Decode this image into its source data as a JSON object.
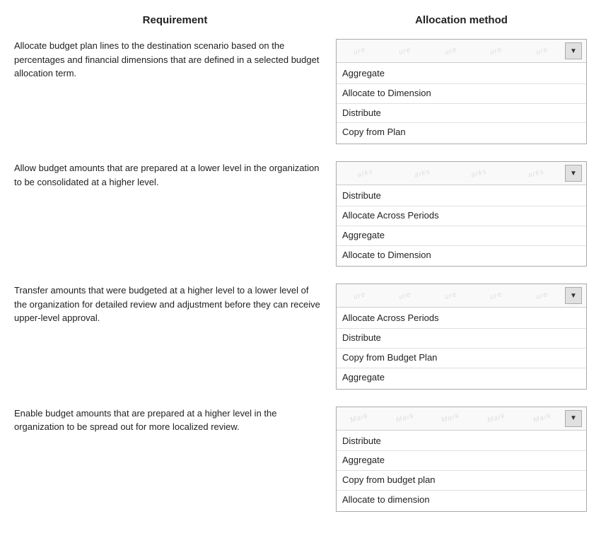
{
  "headers": {
    "requirement": "Requirement",
    "allocation_method": "Allocation method"
  },
  "rows": [
    {
      "id": "row1",
      "requirement": "Allocate budget plan lines to the destination scenario based on the percentages and financial dimensions that are defined in a selected budget allocation term.",
      "options": [
        "Aggregate",
        "Allocate to Dimension",
        "Distribute",
        "Copy from Plan"
      ],
      "watermarks": [
        "ure",
        "ure",
        "ure",
        "ure",
        "ure"
      ]
    },
    {
      "id": "row2",
      "requirement": "Allow budget amounts that are prepared at a lower level in the organization to be consolidated at a higher level.",
      "options": [
        "Distribute",
        "Allocate Across Periods",
        "Aggregate",
        "Allocate to Dimension"
      ],
      "watermarks": [
        "arks",
        "arks",
        "arks",
        "arks"
      ]
    },
    {
      "id": "row3",
      "requirement": "Transfer amounts that were budgeted at a higher level to a lower level of the organization for detailed review and adjustment before they can receive upper-level approval.",
      "options": [
        "Allocate Across Periods",
        "Distribute",
        "Copy from Budget Plan",
        "Aggregate"
      ],
      "watermarks": [
        "ure",
        "ure",
        "ure",
        "ure",
        "ure"
      ]
    },
    {
      "id": "row4",
      "requirement": "Enable budget amounts that are prepared at a higher level in the organization to be spread out for more localized review.",
      "options": [
        "Distribute",
        "Aggregate",
        "Copy from budget plan",
        "Allocate to dimension"
      ],
      "watermarks": [
        "Mark",
        "Mark",
        "Mark",
        "Mark",
        "Mark"
      ]
    }
  ],
  "arrow_char": "▼"
}
